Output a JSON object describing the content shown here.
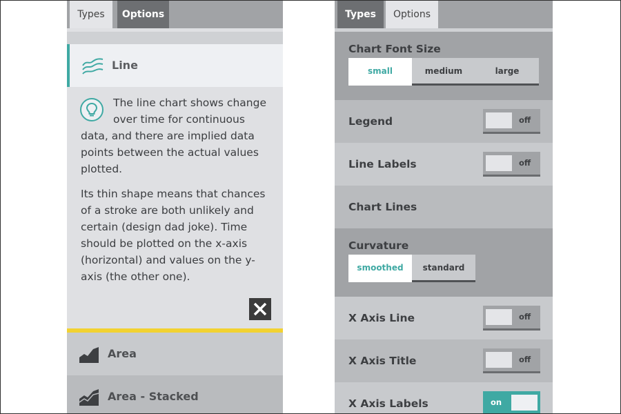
{
  "left": {
    "tabs": {
      "types": "Types",
      "options": "Options"
    },
    "selected_type": {
      "label": "Line",
      "icon": "line-chart-icon"
    },
    "description": {
      "p1_first": "The line chart shows change over time for continuous",
      "p1_rest": "data, and there are implied data points between the actual values plotted.",
      "p2": "Its thin shape means that chances of a stroke are both unlikely and certain (design dad joke). Time should be plotted on the x-axis (horizontal) and values on the y-axis (the other one)."
    },
    "types": [
      {
        "label": "Area",
        "icon": "area-chart-icon"
      },
      {
        "label": "Area - Stacked",
        "icon": "stacked-area-chart-icon"
      }
    ]
  },
  "right": {
    "tabs": {
      "types": "Types",
      "options": "Options"
    },
    "font_size": {
      "title": "Chart Font Size",
      "options": [
        "small",
        "medium",
        "large"
      ],
      "selected": "small"
    },
    "legend": {
      "label": "Legend",
      "state": "off"
    },
    "line_labels": {
      "label": "Line Labels",
      "state": "off"
    },
    "chart_lines": {
      "label": "Chart Lines"
    },
    "curvature": {
      "title": "Curvature",
      "options": [
        "smoothed",
        "standard"
      ],
      "selected": "smoothed"
    },
    "x_axis_line": {
      "label": "X Axis Line",
      "state": "off"
    },
    "x_axis_title": {
      "label": "X Axis Title",
      "state": "off"
    },
    "x_axis_labels": {
      "label": "X Axis Labels",
      "state": "on"
    }
  },
  "colors": {
    "accent": "#3fa9a3",
    "highlight": "#f2d231",
    "panel": "#c8cacd",
    "dark_tab": "#6d6f72"
  }
}
